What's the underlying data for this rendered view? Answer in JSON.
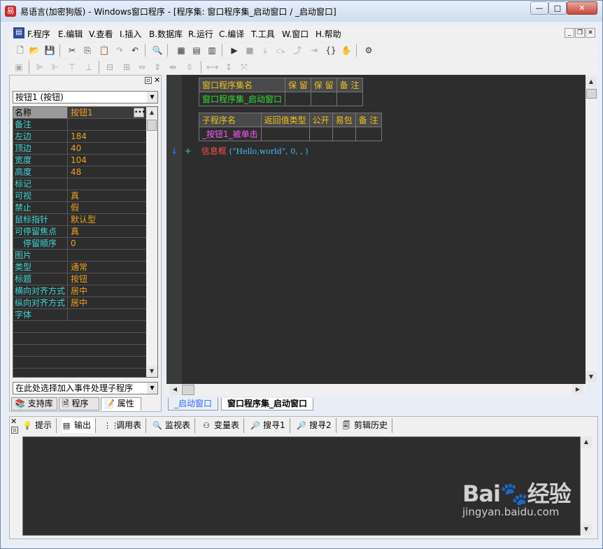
{
  "window": {
    "title": "易语言(加密狗版) - Windows窗口程序 - [程序集: 窗口程序集_启动窗口 / _启动窗口]",
    "min_symbol": "—",
    "max_symbol": "□",
    "close_symbol": "✕"
  },
  "menu": {
    "items": [
      "F.程序",
      "E.编辑",
      "V.查看",
      "I.插入",
      "B.数据库",
      "R.运行",
      "C.编译",
      "T.工具",
      "W.窗口",
      "H.帮助"
    ]
  },
  "property_panel": {
    "component": "按钮1 (按钮)",
    "properties": [
      {
        "name": "名称",
        "value": "按钮1"
      },
      {
        "name": "备注",
        "value": ""
      },
      {
        "name": "左边",
        "value": "184"
      },
      {
        "name": "顶边",
        "value": "40"
      },
      {
        "name": "宽度",
        "value": "104"
      },
      {
        "name": "高度",
        "value": "48"
      },
      {
        "name": "标记",
        "value": ""
      },
      {
        "name": "可视",
        "value": "真"
      },
      {
        "name": "禁止",
        "value": "假"
      },
      {
        "name": "鼠标指针",
        "value": "默认型"
      },
      {
        "name": "可停留焦点",
        "value": "真"
      },
      {
        "name": "停留顺序",
        "value": "0"
      },
      {
        "name": "图片",
        "value": ""
      },
      {
        "name": "类型",
        "value": "通常"
      },
      {
        "name": "标题",
        "value": "按钮"
      },
      {
        "name": "横向对齐方式",
        "value": "居中"
      },
      {
        "name": "纵向对齐方式",
        "value": "居中"
      },
      {
        "name": "字体",
        "value": ""
      }
    ],
    "event_selector": "在此处选择加入事件处理子程序",
    "tabs": [
      "支持库",
      "程序",
      "属性"
    ]
  },
  "editor": {
    "assembly_table": {
      "headers": [
        "窗口程序集名",
        "保 留",
        "保 留",
        "备 注"
      ],
      "row": [
        "窗口程序集_启动窗口",
        "",
        "",
        ""
      ]
    },
    "sub_table": {
      "headers": [
        "子程序名",
        "返回值类型",
        "公开",
        "易包",
        "备 注"
      ],
      "row": [
        "_按钮1_被单击",
        "",
        "",
        "",
        ""
      ]
    },
    "code": {
      "func": "信息框",
      "args": " (“Hello,world”, 0, , )"
    },
    "tabs": [
      "_启动窗口",
      "窗口程序集_启动窗口"
    ]
  },
  "bottom_panel": {
    "tabs": [
      "提示",
      "输出",
      "调用表",
      "监视表",
      "变量表",
      "搜寻1",
      "搜寻2",
      "剪辑历史"
    ]
  },
  "watermark": {
    "logo": "Bai🐾经验",
    "url": "jingyan.baidu.com"
  },
  "colors": {
    "editor_bg": "#2d2d2d",
    "prop_name": "#3fd4d4",
    "prop_value": "#f0a020",
    "table_header": "#f0c020",
    "assembly_name": "#33dd33",
    "sub_name": "#ff55ff",
    "code_func": "#ff5050",
    "code_args": "#40c0ff"
  }
}
